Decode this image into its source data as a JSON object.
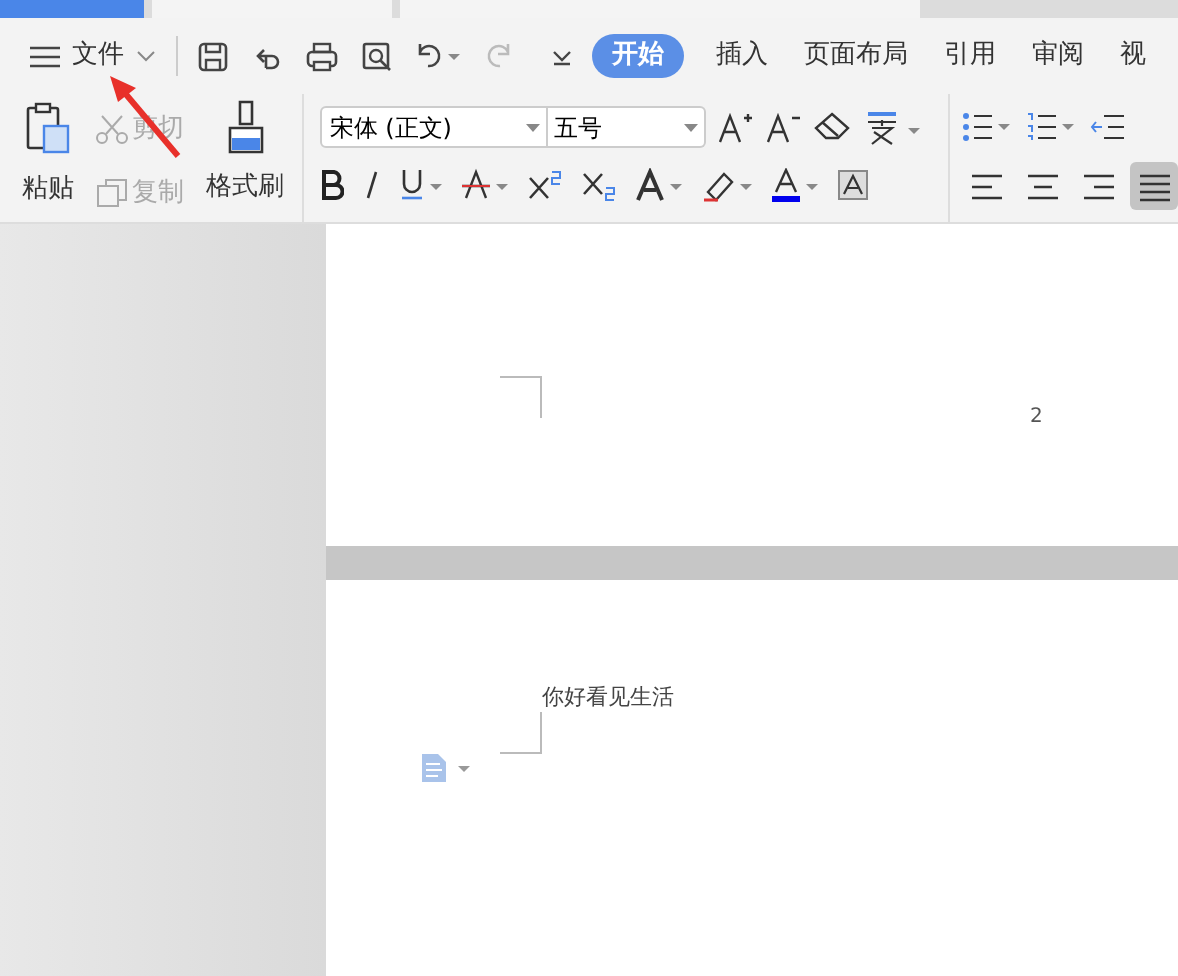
{
  "window_tabs": [
    {
      "selected": true
    },
    {
      "selected": false
    },
    {
      "selected": false
    }
  ],
  "file_menu": {
    "label": "文件"
  },
  "ribbon_tabs": [
    {
      "label": "开始",
      "selected": true
    },
    {
      "label": "插入",
      "selected": false
    },
    {
      "label": "页面布局",
      "selected": false
    },
    {
      "label": "引用",
      "selected": false
    },
    {
      "label": "审阅",
      "selected": false
    },
    {
      "label": "视",
      "selected": false
    }
  ],
  "clipboard": {
    "paste": "粘贴",
    "cut": {
      "label": "剪切",
      "disabled": true
    },
    "copy": {
      "label": "复制",
      "disabled": true
    },
    "format_painter": "格式刷"
  },
  "font": {
    "family": "宋体 (正文)",
    "size": "五号"
  },
  "alignment": [
    {
      "kind": "left",
      "selected": false
    },
    {
      "kind": "center",
      "selected": false
    },
    {
      "kind": "right",
      "selected": false
    },
    {
      "kind": "justify",
      "selected": true
    }
  ],
  "document": {
    "page_number": "2",
    "text": "你好看见生活"
  }
}
